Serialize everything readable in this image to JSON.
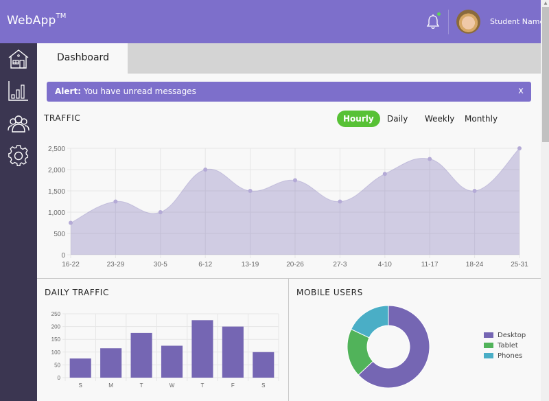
{
  "app": {
    "title": "WebApp",
    "trademark": "TM"
  },
  "header": {
    "user_name": "Student Name",
    "notification_icon": "bell-icon",
    "has_unread": true
  },
  "sidebar": {
    "items": [
      {
        "name": "home",
        "icon": "house-icon"
      },
      {
        "name": "analytics",
        "icon": "bar-chart-icon"
      },
      {
        "name": "users",
        "icon": "users-icon"
      },
      {
        "name": "settings",
        "icon": "gear-icon"
      }
    ]
  },
  "tabs": [
    {
      "label": "Dashboard",
      "active": true
    }
  ],
  "alert": {
    "label": "Alert:",
    "message": "You have unread messages",
    "close": "x"
  },
  "traffic": {
    "title": "TRAFFIC",
    "periods": [
      "Hourly",
      "Daily",
      "Weekly",
      "Monthly"
    ],
    "active_period": "Hourly"
  },
  "daily_traffic": {
    "title": "DAILY TRAFFIC"
  },
  "mobile_users": {
    "title": "MOBILE USERS"
  },
  "colors": {
    "brand": "#7d6fcb",
    "sidebar": "#3b3651",
    "active_green": "#57c135",
    "bar": "#7566b3",
    "area_fill": "#d3cde6",
    "desktop": "#7566b3",
    "tablet": "#51b35a",
    "phones": "#4aaec6"
  },
  "chart_data": [
    {
      "type": "area",
      "title": "TRAFFIC",
      "categories": [
        "16-22",
        "23-29",
        "30-5",
        "6-12",
        "13-19",
        "20-26",
        "27-3",
        "4-10",
        "11-17",
        "18-24",
        "25-31"
      ],
      "values": [
        750,
        1250,
        1000,
        2000,
        1500,
        1750,
        1250,
        1900,
        2250,
        1500,
        2500
      ],
      "yticks": [
        "0",
        "500",
        "1,000",
        "1,500",
        "2,000",
        "2,500"
      ],
      "ylim": [
        0,
        2500
      ],
      "grid": true,
      "xlabel": "",
      "ylabel": ""
    },
    {
      "type": "bar",
      "title": "DAILY TRAFFIC",
      "categories": [
        "S",
        "M",
        "T",
        "W",
        "T",
        "F",
        "S"
      ],
      "values": [
        75,
        115,
        175,
        125,
        225,
        200,
        100
      ],
      "yticks": [
        "0",
        "50",
        "100",
        "150",
        "200",
        "250"
      ],
      "ylim": [
        0,
        250
      ],
      "grid": true,
      "xlabel": "",
      "ylabel": ""
    },
    {
      "type": "pie",
      "subtype": "donut",
      "title": "MOBILE USERS",
      "labels": [
        "Desktop",
        "Tablet",
        "Phones"
      ],
      "values": [
        63,
        19,
        18
      ],
      "legend": "right"
    }
  ]
}
